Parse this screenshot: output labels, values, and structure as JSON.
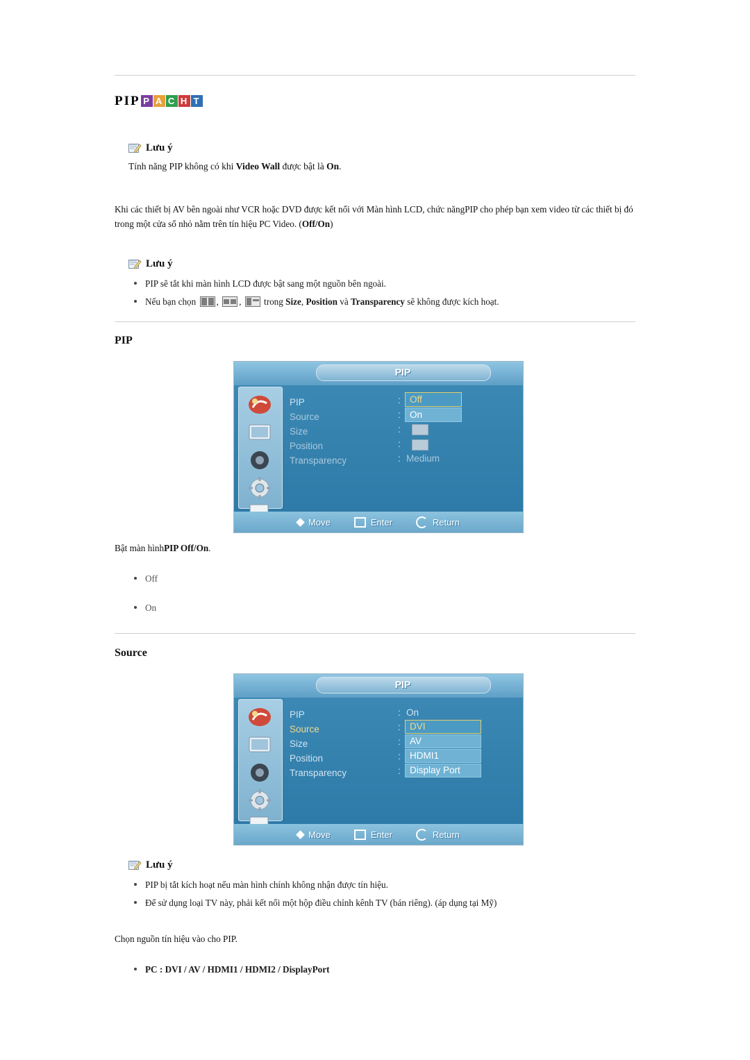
{
  "title": {
    "plain": "PIP",
    "chips": [
      {
        "letter": "P",
        "color": "#7b3fa0"
      },
      {
        "letter": "A",
        "color": "#e8a13a"
      },
      {
        "letter": "C",
        "color": "#2f9e4f"
      },
      {
        "letter": "H",
        "color": "#cf3b3b"
      },
      {
        "letter": "T",
        "color": "#2f6fb5"
      }
    ]
  },
  "note1": {
    "heading": "Lưu ý",
    "text_pre": "Tính năng PIP không có khi ",
    "text_bold1": "Video Wall",
    "text_mid": " được bật là ",
    "text_bold2": "On",
    "text_end": "."
  },
  "paragraph": {
    "line1": "Khi các thiết bị AV bên ngoài như VCR hoặc DVD được kết nối với Màn hình LCD, chức năngPIP cho phép bạn xem video từ các thiết bị đó",
    "line2_pre": "trong một cửa sổ nhỏ nằm trên tín hiệu PC Video. (",
    "line2_bold": "Off/On",
    "line2_end": ")"
  },
  "note2": {
    "heading": "Lưu ý",
    "item1": "PIP sẽ tắt khi màn hình LCD được bật sang một nguồn bên ngoài.",
    "item2_pre": "Nếu bạn chọn",
    "item2_mid": "trong",
    "item2_b1": "Size",
    "item2_b2": "Position",
    "item2_and": "và",
    "item2_b3": "Transparency",
    "item2_end": "sẽ không được kích hoạt."
  },
  "section_pip": {
    "heading": "PIP",
    "caption_pre": "Bật màn hình",
    "caption_bold": "PIP Off/On",
    "caption_end": ".",
    "options": [
      "Off",
      "On"
    ]
  },
  "section_source": {
    "heading": "Source",
    "note": {
      "heading": "Lưu ý",
      "item1": "PIP bị tắt kích hoạt nếu màn hình chính không nhận được tín hiệu.",
      "item2": "Để sử dụng loại TV này, phải kết nối một hộp điều chỉnh kênh TV (bán riêng). (áp dụng tại Mỹ)"
    },
    "caption": "Chọn nguồn tín hiệu vào cho PIP.",
    "options": [
      "PC : DVI / AV / HDMI1 / HDMI2 / DisplayPort"
    ]
  },
  "osd1": {
    "title": "PIP",
    "menu": [
      "PIP",
      "Source",
      "Size",
      "Position",
      "Transparency"
    ],
    "values": {
      "transparency": "Medium"
    },
    "dropdown": [
      "Off",
      "On"
    ],
    "footer": {
      "move": "Move",
      "enter": "Enter",
      "return": "Return"
    }
  },
  "osd2": {
    "title": "PIP",
    "menu": [
      "PIP",
      "Source",
      "Size",
      "Position",
      "Transparency"
    ],
    "values": {
      "pip": "On"
    },
    "dropdown": [
      "DVI",
      "AV",
      "HDMI1",
      "Display Port"
    ],
    "footer": {
      "move": "Move",
      "enter": "Enter",
      "return": "Return"
    }
  }
}
